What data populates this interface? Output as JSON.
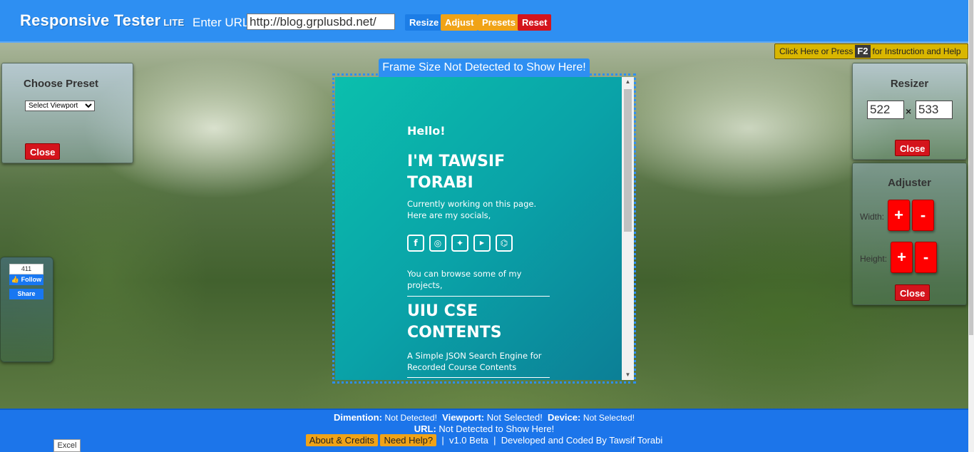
{
  "header": {
    "brand": "Responsive Tester",
    "brand_suffix": "LITE",
    "url_label": "Enter URL:",
    "url_value": "http://blog.grplusbd.net/",
    "buttons": {
      "resize": "Resize",
      "adjust": "Adjust",
      "presets": "Presets",
      "reset": "Reset"
    }
  },
  "help": {
    "prefix": "Click Here or Press",
    "key": "F2",
    "suffix": "for Instruction and Help"
  },
  "preset_panel": {
    "title": "Choose Preset",
    "select_value": "Select Viewport",
    "close": "Close"
  },
  "social_widget": {
    "count": "411",
    "follow": "Follow",
    "share": "Share"
  },
  "frame": {
    "label": "Frame Size Not Detected to Show Here!",
    "site": {
      "hello": "Hello!",
      "name": "I'M TAWSIF TORABI",
      "desc": "Currently working on this page. Here are my socials,",
      "socials": [
        "facebook-icon",
        "instagram-icon",
        "twitter-icon",
        "youtube-icon",
        "github-icon"
      ],
      "browse": "You can browse some of my projects,",
      "project_title": "UIU CSE CONTENTS",
      "project_desc": "A Simple JSON Search Engine for Recorded Course Contents"
    }
  },
  "resizer": {
    "title": "Resizer",
    "width": "522",
    "height": "533",
    "separator": "×",
    "close": "Close"
  },
  "adjuster": {
    "title": "Adjuster",
    "width_label": "Width:",
    "height_label": "Height:",
    "plus": "+",
    "minus": "-",
    "close": "Close"
  },
  "footer": {
    "dimension_label": "Dimention:",
    "dimension_value": "Not Detected!",
    "viewport_label": "Viewport:",
    "viewport_value": "Not Selected!",
    "device_label": "Device:",
    "device_value": "Not Selected!",
    "url_label": "URL:",
    "url_value": "Not Detected to Show Here!",
    "about": "About & Credits",
    "help": "Need Help?",
    "version": "v1.0 Beta",
    "credit": "Developed and Coded By Tawsif Torabi",
    "sep": "|"
  },
  "tooltip": "Excel",
  "colors": {
    "header": "#2e8ff2",
    "accent_orange": "#f0a317",
    "danger": "#d4141c",
    "footer": "#1c75ea"
  }
}
